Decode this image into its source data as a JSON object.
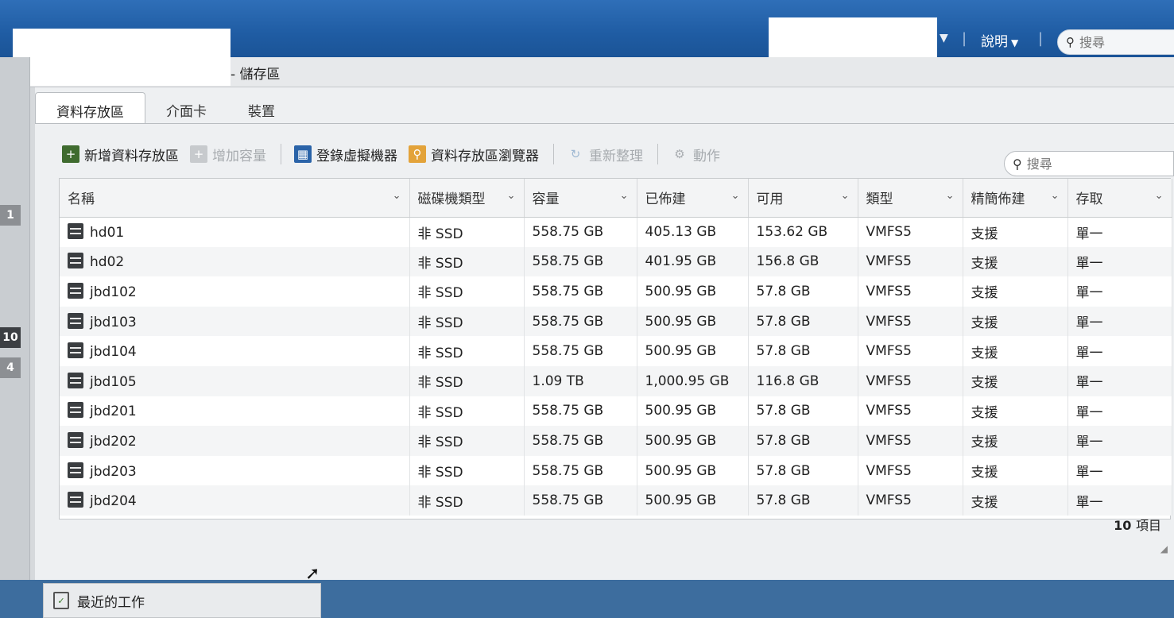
{
  "header": {
    "help_label": "說明",
    "search_placeholder": "搜尋"
  },
  "breadcrumb": {
    "title": "- 儲存區"
  },
  "left_badges": [
    "1",
    "10",
    "4"
  ],
  "tabs": [
    {
      "label": "資料存放區",
      "active": true
    },
    {
      "label": "介面卡",
      "active": false
    },
    {
      "label": "裝置",
      "active": false
    }
  ],
  "toolbar": {
    "add_datastore": "新增資料存放區",
    "increase_capacity": "增加容量",
    "register_vm": "登錄虛擬機器",
    "datastore_browser": "資料存放區瀏覽器",
    "refresh": "重新整理",
    "actions": "動作"
  },
  "table_search_placeholder": "搜尋",
  "columns": [
    "名稱",
    "磁碟機類型",
    "容量",
    "已佈建",
    "可用",
    "類型",
    "精簡佈建",
    "存取"
  ],
  "rows": [
    {
      "name": "hd01",
      "drive_type": "非 SSD",
      "capacity": "558.75 GB",
      "provisioned": "405.13 GB",
      "free": "153.62 GB",
      "type": "VMFS5",
      "thin": "支援",
      "access": "單一"
    },
    {
      "name": "hd02",
      "drive_type": "非 SSD",
      "capacity": "558.75 GB",
      "provisioned": "401.95 GB",
      "free": "156.8 GB",
      "type": "VMFS5",
      "thin": "支援",
      "access": "單一"
    },
    {
      "name": "jbd102",
      "drive_type": "非 SSD",
      "capacity": "558.75 GB",
      "provisioned": "500.95 GB",
      "free": "57.8 GB",
      "type": "VMFS5",
      "thin": "支援",
      "access": "單一"
    },
    {
      "name": "jbd103",
      "drive_type": "非 SSD",
      "capacity": "558.75 GB",
      "provisioned": "500.95 GB",
      "free": "57.8 GB",
      "type": "VMFS5",
      "thin": "支援",
      "access": "單一"
    },
    {
      "name": "jbd104",
      "drive_type": "非 SSD",
      "capacity": "558.75 GB",
      "provisioned": "500.95 GB",
      "free": "57.8 GB",
      "type": "VMFS5",
      "thin": "支援",
      "access": "單一"
    },
    {
      "name": "jbd105",
      "drive_type": "非 SSD",
      "capacity": "1.09 TB",
      "provisioned": "1,000.95 GB",
      "free": "116.8 GB",
      "type": "VMFS5",
      "thin": "支援",
      "access": "單一"
    },
    {
      "name": "jbd201",
      "drive_type": "非 SSD",
      "capacity": "558.75 GB",
      "provisioned": "500.95 GB",
      "free": "57.8 GB",
      "type": "VMFS5",
      "thin": "支援",
      "access": "單一"
    },
    {
      "name": "jbd202",
      "drive_type": "非 SSD",
      "capacity": "558.75 GB",
      "provisioned": "500.95 GB",
      "free": "57.8 GB",
      "type": "VMFS5",
      "thin": "支援",
      "access": "單一"
    },
    {
      "name": "jbd203",
      "drive_type": "非 SSD",
      "capacity": "558.75 GB",
      "provisioned": "500.95 GB",
      "free": "57.8 GB",
      "type": "VMFS5",
      "thin": "支援",
      "access": "單一"
    },
    {
      "name": "jbd204",
      "drive_type": "非 SSD",
      "capacity": "558.75 GB",
      "provisioned": "500.95 GB",
      "free": "57.8 GB",
      "type": "VMFS5",
      "thin": "支援",
      "access": "單一"
    }
  ],
  "item_count": "10",
  "item_count_label": "項目",
  "recent_tasks": "最近的工作"
}
